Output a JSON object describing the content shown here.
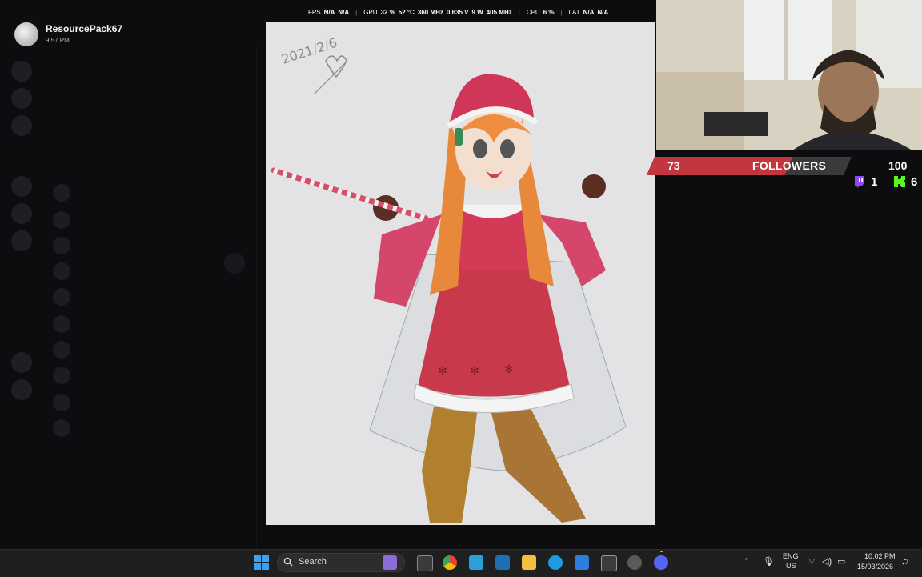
{
  "notification": {
    "name": "ResourcePack67",
    "time": "9:57 PM"
  },
  "overlay_stats": {
    "fps_label": "FPS",
    "fps_value": "N/A",
    "fps_value2": "N/A",
    "gpu_label": "GPU",
    "gpu_util": "32 %",
    "gpu_temp": "52 °C",
    "gpu_clock": "360 MHz",
    "gpu_volt": "0.635 V",
    "gpu_power": "9 W",
    "gpu_mem": "405 MHz",
    "cpu_label": "CPU",
    "cpu_util": "6 %",
    "lat_label": "LAT",
    "lat_value": "N/A",
    "lat_value2": "N/A"
  },
  "drawing": {
    "signature": "2021/2/6"
  },
  "followers": {
    "count": "73",
    "label": "FOLLOWERS",
    "goal": "100",
    "twitch_count": "1",
    "kick_count": "6",
    "bar_color": "#c4363f",
    "twitch_color": "#9146ff",
    "kick_color": "#53fc18"
  },
  "taskbar": {
    "search_label": "Search",
    "lang_top": "ENG",
    "lang_bottom": "US",
    "time": "10:02 PM",
    "date": "15/03/2026"
  }
}
